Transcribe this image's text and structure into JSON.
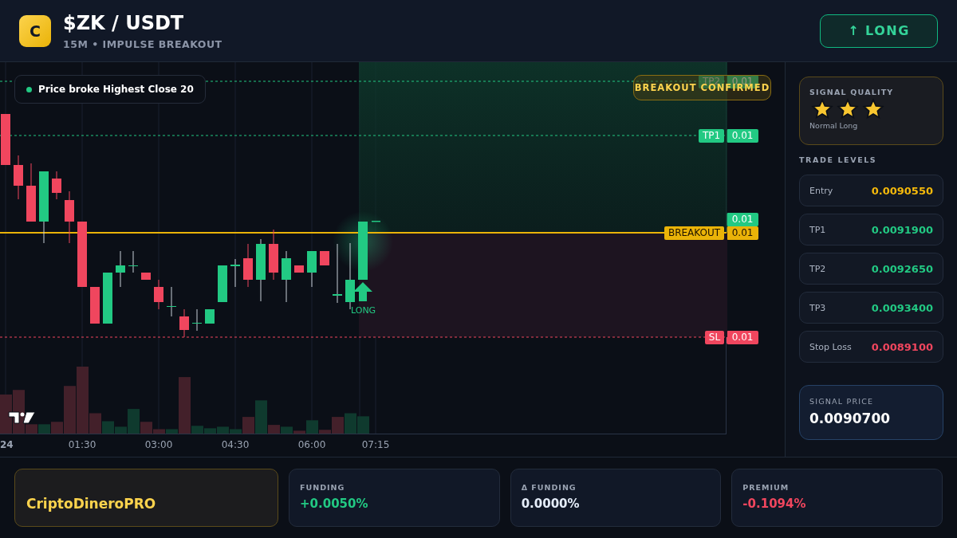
{
  "header": {
    "logo_letter": "C",
    "pair": "$ZK / USDT",
    "subtitle": "15M • IMPULSE BREAKOUT",
    "action_button": "↑ LONG"
  },
  "chart": {
    "alert": "Price broke Highest Close 20",
    "status_badge": "BREAKOUT CONFIRMED",
    "levels": [
      {
        "kind": "profit",
        "tag": "TP2",
        "price": "0.01"
      },
      {
        "kind": "profit",
        "tag": "TP1",
        "price": "0.01"
      },
      {
        "kind": "breakout",
        "tag": "BREAKOUT",
        "price": "0.01"
      },
      {
        "kind": "loss",
        "tag": "SL",
        "price": "0.01"
      }
    ],
    "current_price": "0.01",
    "signal_marker": "LONG",
    "time_labels": [
      "24",
      "01:30",
      "03:00",
      "04:30",
      "06:00",
      "07:15"
    ]
  },
  "sidebar": {
    "signal_quality": {
      "title": "SIGNAL QUALITY",
      "stars": 3,
      "caption": "Normal Long"
    },
    "trade_levels_title": "TRADE LEVELS",
    "trade_levels": [
      {
        "label": "Entry",
        "value": "0.0090550",
        "kind": "entry"
      },
      {
        "label": "TP1",
        "value": "0.0091900",
        "kind": "profit"
      },
      {
        "label": "TP2",
        "value": "0.0092650",
        "kind": "profit"
      },
      {
        "label": "TP3",
        "value": "0.0093400",
        "kind": "profit"
      },
      {
        "label": "Stop Loss",
        "value": "0.0089100",
        "kind": "loss"
      }
    ],
    "signal_price": {
      "label": "SIGNAL PRICE",
      "value": "0.0090700"
    }
  },
  "footer": {
    "brand": "CriptoDineroPRO",
    "stats": [
      {
        "label": "FUNDING",
        "value": "+0.0050%",
        "color": "#22c983"
      },
      {
        "label": "Δ FUNDING",
        "value": "0.0000%",
        "color": "#e5edf9"
      },
      {
        "label": "PREMIUM",
        "value": "-0.1094%",
        "color": "#f0465e"
      }
    ]
  }
}
